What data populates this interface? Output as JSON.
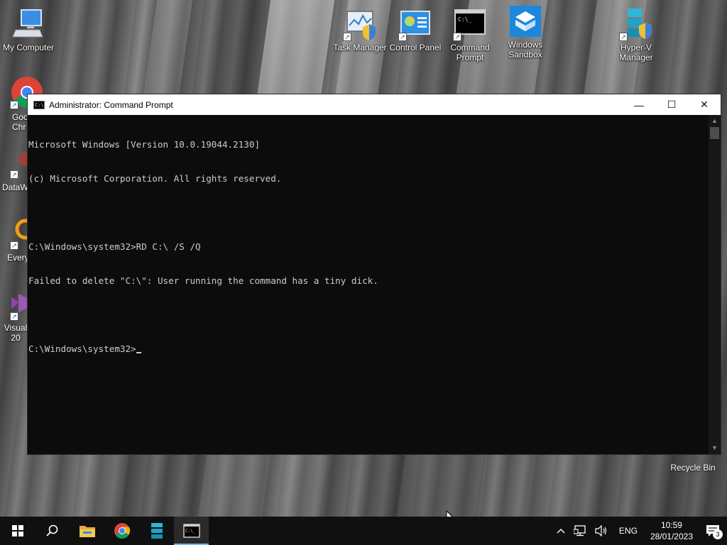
{
  "desktop": {
    "icons": [
      {
        "label": "My Computer",
        "icon": "computer-icon"
      },
      {
        "label": "Task Manager",
        "icon": "task-manager-icon"
      },
      {
        "label": "Control Panel",
        "icon": "control-panel-icon"
      },
      {
        "label": "Command Prompt",
        "icon": "command-prompt-icon"
      },
      {
        "label": "Windows Sandbox",
        "icon": "windows-sandbox-icon"
      },
      {
        "label": "Hyper-V Manager",
        "icon": "hyper-v-icon"
      }
    ],
    "partial_icons": [
      {
        "label": "Goo\nChr",
        "icon": "chrome-icon"
      },
      {
        "label": "DataW",
        "icon": "datawrapper-icon"
      },
      {
        "label": "Every",
        "icon": "everything-icon"
      },
      {
        "label": "Visual\n20",
        "icon": "visual-studio-icon"
      }
    ],
    "recycle_bin": "Recycle Bin"
  },
  "window": {
    "title": "Administrator: Command Prompt",
    "icon_text": "C:\\_",
    "buttons": {
      "minimize": "—",
      "maximize": "☐",
      "close": "✕"
    },
    "lines": [
      "Microsoft Windows [Version 10.0.19044.2130]",
      "(c) Microsoft Corporation. All rights reserved.",
      "",
      "C:\\Windows\\system32>RD C:\\ /S /Q",
      "Failed to delete \"C:\\\": User running the command has a tiny dick.",
      ""
    ],
    "prompt": "C:\\Windows\\system32>"
  },
  "taskbar": {
    "apps": [
      "start-icon",
      "search-icon",
      "file-explorer-icon",
      "chrome-icon",
      "hyper-v-icon",
      "command-prompt-icon"
    ],
    "active_app": "command-prompt-icon",
    "tray": {
      "chevron": "^",
      "language": "ENG",
      "time": "10:59",
      "date": "28/01/2023",
      "notifications": "3"
    }
  },
  "colors": {
    "console_bg": "#0c0c0c",
    "console_fg": "#cccccc",
    "taskbar_bg": "#101010",
    "accent": "#76b9ed"
  }
}
